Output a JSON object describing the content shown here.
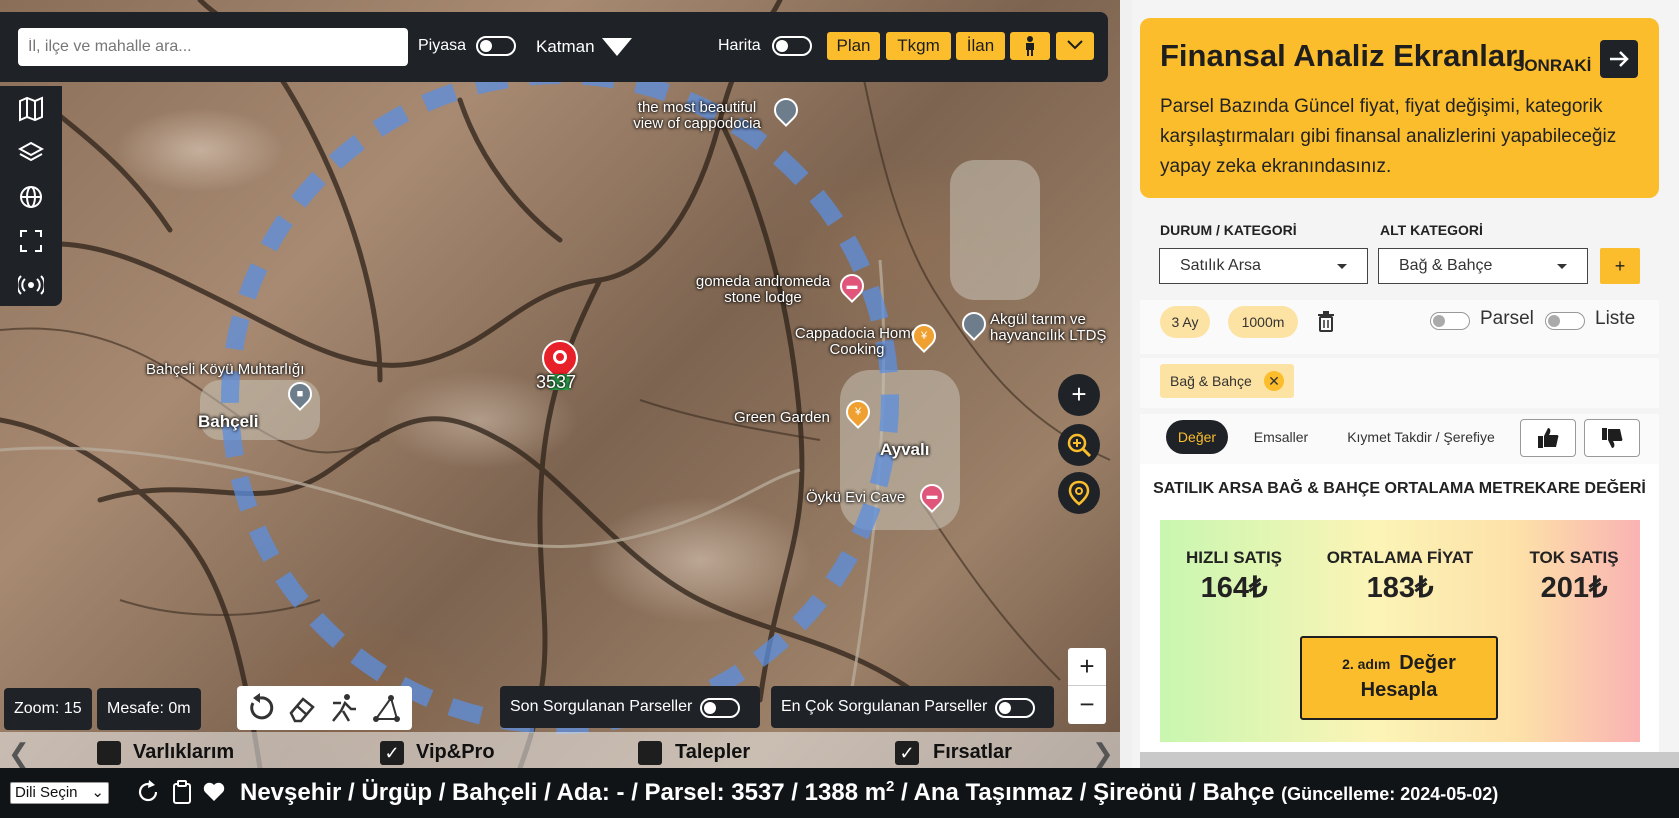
{
  "search": {
    "placeholder": "İl, ilçe ve mahalle ara..."
  },
  "topbar": {
    "piyasa_label": "Piyasa",
    "katman_label": "Katman",
    "harita_label": "Harita",
    "buttons": [
      "Plan",
      "Tkgm",
      "İlan"
    ]
  },
  "map": {
    "labels": {
      "beautiful": "the most beautiful view of cappodocia",
      "gomeda": "gomeda andromeda stone lodge",
      "cappadocia": "Cappadocia Home Cooking",
      "akgul": "Akgül tarım ve hayvancılık LTDŞ",
      "muhtarlik": "Bahçeli Köyü Muhtarlığı",
      "bahceli": "Bahçeli",
      "green": "Green Garden",
      "ayvali": "Ayvalı",
      "oyku": "Öykü Evi Cave"
    },
    "parcel_marker": "3537",
    "zoom_text": "Zoom: 15",
    "mesafe_text": "Mesafe: 0m",
    "son_sorgulanan": "Son Sorgulanan Parseller",
    "en_cok_sorgulanan": "En Çok Sorgulanan Parseller"
  },
  "strip": {
    "items": [
      {
        "label": "Varlıklarım",
        "checked": false
      },
      {
        "label": "Vip&Pro",
        "checked": true
      },
      {
        "label": "Talepler",
        "checked": false
      },
      {
        "label": "Fırsatlar",
        "checked": true
      }
    ]
  },
  "footer": {
    "language": "Dili Seçin",
    "address_pre": "Nevşehir / Ürgüp / Bahçeli / Ada: - / Parsel: 3537 / 1388 m",
    "address_sup": "2",
    "address_post": " / Ana Taşınmaz / Şireönü / Bahçe",
    "update": "(Güncelleme: 2024-05-02)"
  },
  "panel": {
    "card": {
      "title": "Finansal Analiz Ekranları",
      "next": "SONRAKİ",
      "desc": "Parsel Bazında Güncel fiyat, fiyat değişimi, kategorik karşılaştırmaları gibi finansal analizlerini yapabileceğiz yapay zeka ekranındasınız."
    },
    "durum_label": "DURUM / KATEGORİ",
    "durum_value": "Satılık Arsa",
    "alt_label": "ALT KATEGORİ",
    "alt_value": "Bağ & Bahçe",
    "plus": "+",
    "pill_period": "3 Ay",
    "pill_distance": "1000m",
    "parsel_label": "Parsel",
    "liste_label": "Liste",
    "tag": "Bağ & Bahçe",
    "tabs": [
      "Değer",
      "Emsaller",
      "Kıymet Takdir / Şerefiye"
    ],
    "value_title": "SATILIK ARSA BAĞ & BAHÇE ORTALAMA METREKARE DEĞERİ",
    "hizli_label": "HIZLI SATIŞ",
    "hizli_value": "164₺",
    "ortalama_label": "ORTALAMA FİYAT",
    "ortalama_value": "183₺",
    "tok_label": "TOK SATIŞ",
    "tok_value": "201₺",
    "calc_step": "2. adım",
    "calc_main1": "Değer",
    "calc_main2": "Hesapla"
  },
  "colors": {
    "accent": "#fbbd2c",
    "dark": "#1f2328",
    "circle": "#5b8fe0"
  }
}
